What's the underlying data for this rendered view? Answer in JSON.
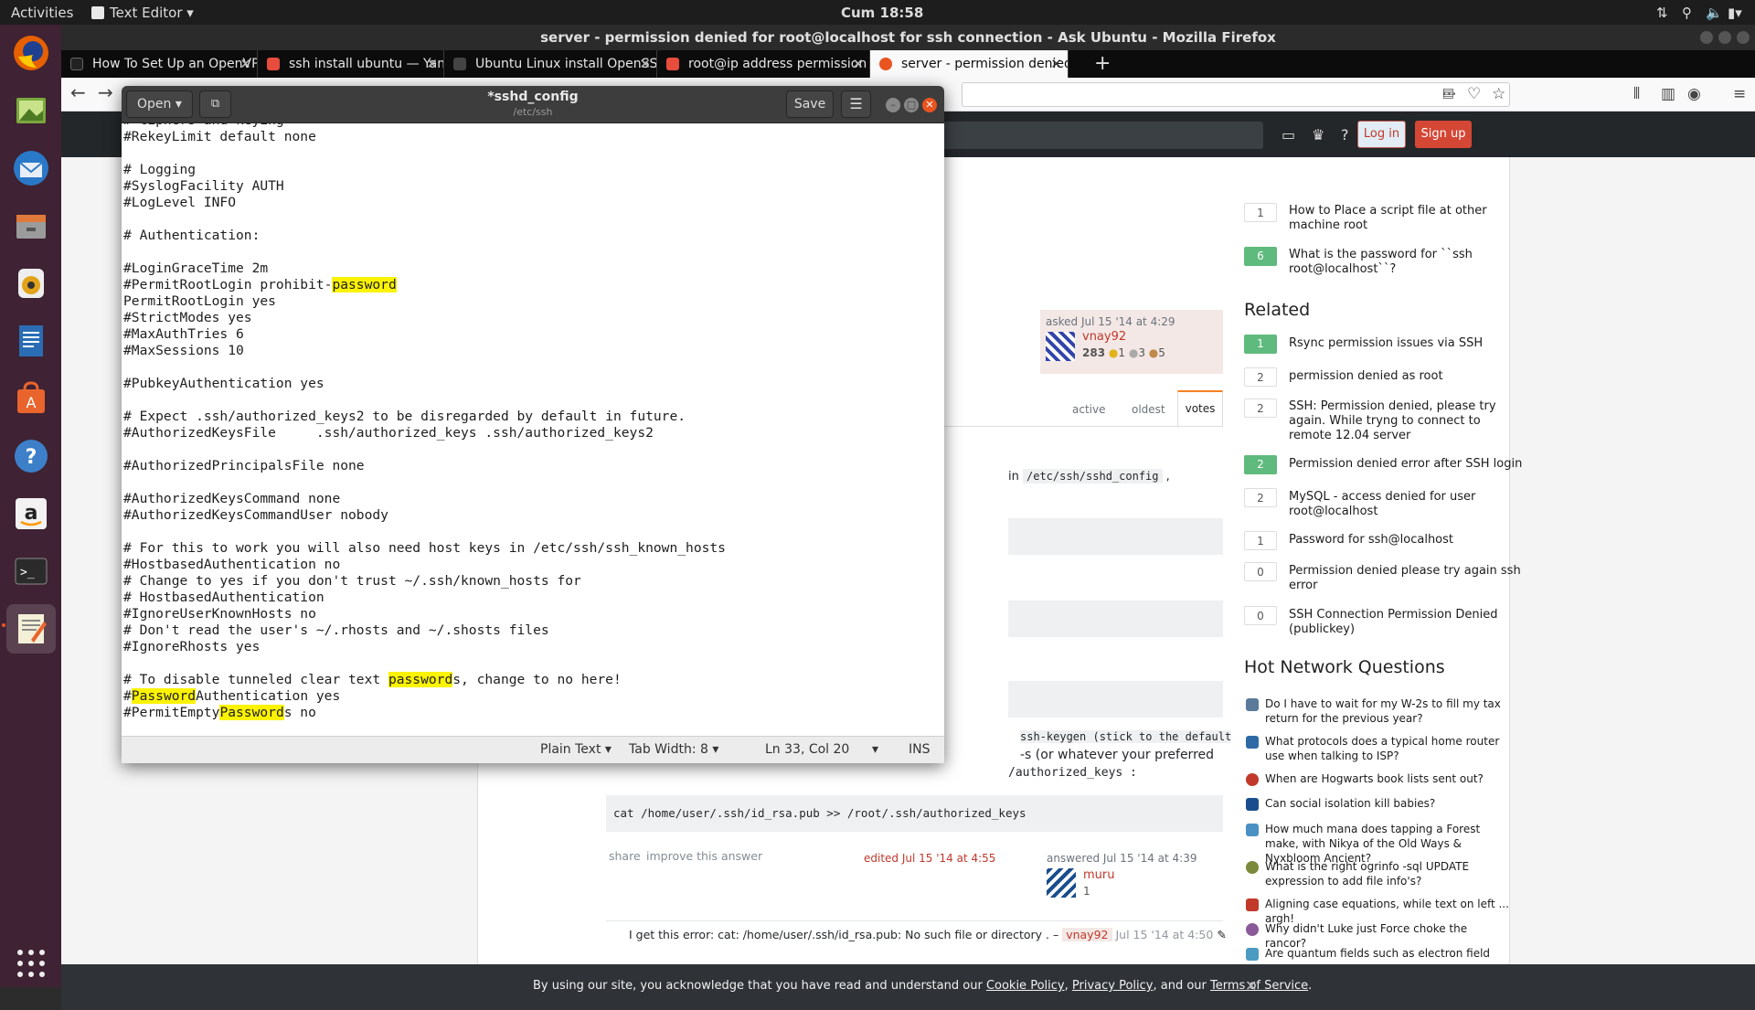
{
  "topbar": {
    "activities": "Activities",
    "app_menu": "Text Editor",
    "clock": "Cum 18:58"
  },
  "firefox": {
    "window_title": "server - permission denied for root@localhost for ssh connection - Ask Ubuntu - Mozilla Firefox",
    "tabs": [
      {
        "label": "How To Set Up an OpenVPN",
        "favicon_color": "#222222"
      },
      {
        "label": "ssh install ubuntu — Yandex",
        "favicon_color": "#e74c3c"
      },
      {
        "label": "Ubuntu Linux install OpenSSH",
        "favicon_color": "#444444"
      },
      {
        "label": "root@ip address permission",
        "favicon_color": "#e74c3c"
      },
      {
        "label": "server - permission denied",
        "favicon_color": "#e95420"
      }
    ]
  },
  "site": {
    "login_label": "Log in",
    "signup_label": "Sign up",
    "asked": "asked Jul 15 '14 at 4:29",
    "asker_name": "vnay92",
    "asker_rep": "283",
    "asker_badges": [
      "1",
      "3",
      "5"
    ],
    "sort_tabs": [
      "active",
      "oldest",
      "votes"
    ],
    "inline_code_path": "/etc/ssh/sshd_config",
    "inline_text_in": "in",
    "answer_text_1": "ssh-keygen (stick to the default",
    "answer_text_2": "-s (or whatever your preferred",
    "answer_text_3": "/authorized_keys :",
    "code_block": "cat /home/user/.ssh/id_rsa.pub >> /root/.ssh/authorized_keys",
    "share": "share",
    "improve": "improve this answer",
    "edited": "edited Jul 15 '14 at 4:55",
    "answered": "answered Jul 15 '14 at 4:39",
    "answerer_name": "muru",
    "answerer_rep": "1",
    "comment": "I get this error: cat: /home/user/.ssh/id_rsa.pub: No such file or directory . –",
    "comment_user": "vnay92",
    "comment_time": "Jul 15 '14 at 4:50",
    "linked": [
      {
        "votes": "1",
        "answered": false,
        "title": "How to Place a script file at other machine root"
      },
      {
        "votes": "6",
        "answered": true,
        "title": "What is the password for ``ssh root@localhost``?"
      }
    ],
    "related_heading": "Related",
    "related": [
      {
        "votes": "1",
        "answered": true,
        "title": "Rsync permission issues via SSH"
      },
      {
        "votes": "2",
        "answered": false,
        "title": "permission denied as root"
      },
      {
        "votes": "2",
        "answered": false,
        "title": "SSH: Permission denied, please try again. While tryng to connect to remote 12.04 server"
      },
      {
        "votes": "2",
        "answered": true,
        "title": "Permission denied error after SSH login"
      },
      {
        "votes": "2",
        "answered": false,
        "title": "MySQL - access denied for user root@localhost"
      },
      {
        "votes": "1",
        "answered": false,
        "title": "Password for ssh@localhost"
      },
      {
        "votes": "0",
        "answered": false,
        "title": "Permission denied please try again ssh error"
      },
      {
        "votes": "0",
        "answered": false,
        "title": "SSH Connection Permission Denied (publickey)"
      }
    ],
    "hnq_heading": "Hot Network Questions",
    "hnq": [
      {
        "title": "Do I have to wait for my W-2s to fill my tax return for the previous year?",
        "icon_color": "#5b7a9a"
      },
      {
        "title": "What protocols does a typical home router use when talking to ISP?",
        "icon_color": "#2d6aa3"
      },
      {
        "title": "When are Hogwarts book lists sent out?",
        "icon_color": "#c0392b"
      },
      {
        "title": "Can social isolation kill babies?",
        "icon_color": "#1a4d8c"
      },
      {
        "title": "How much mana does tapping a Forest make, with Nikya of the Old Ways & Nyxbloom Ancient?",
        "icon_color": "#4a90c2"
      },
      {
        "title": "What is the right ogrinfo -sql UPDATE expression to add file info's?",
        "icon_color": "#7a8a3a"
      },
      {
        "title": "Aligning case equations, while text on left ... argh!",
        "icon_color": "#c0392b"
      },
      {
        "title": "Why didn't Luke just Force choke the rancor?",
        "icon_color": "#8a5a9a"
      },
      {
        "title": "Are quantum fields such as electron field",
        "icon_color": "#4a9ac2"
      }
    ],
    "cookie_text": "By using our site, you acknowledge that you have read and understand our",
    "cookie_link1": "Cookie Policy",
    "cookie_sep1": ",",
    "cookie_link2": "Privacy Policy",
    "cookie_sep2": ", and our",
    "cookie_link3": "Terms of Service",
    "cookie_end": "."
  },
  "gedit": {
    "open_label": "Open",
    "title": "*sshd_config",
    "subtitle": "/etc/ssh",
    "save_label": "Save",
    "lines": [
      {
        "text": "# Ciphers and keying"
      },
      {
        "text": "#RekeyLimit default none"
      },
      {
        "text": ""
      },
      {
        "text": "# Logging"
      },
      {
        "text": "#SyslogFacility AUTH"
      },
      {
        "text": "#LogLevel INFO"
      },
      {
        "text": ""
      },
      {
        "text": "# Authentication:"
      },
      {
        "text": ""
      },
      {
        "text": "#LoginGraceTime 2m"
      },
      {
        "text": "#PermitRootLogin prohibit-",
        "hl": "password",
        "after": ""
      },
      {
        "text": "PermitRootLogin yes"
      },
      {
        "text": "#StrictModes yes"
      },
      {
        "text": "#MaxAuthTries 6"
      },
      {
        "text": "#MaxSessions 10"
      },
      {
        "text": ""
      },
      {
        "text": "#PubkeyAuthentication yes"
      },
      {
        "text": ""
      },
      {
        "text": "# Expect .ssh/authorized_keys2 to be disregarded by default in future."
      },
      {
        "text": "#AuthorizedKeysFile     .ssh/authorized_keys .ssh/authorized_keys2"
      },
      {
        "text": ""
      },
      {
        "text": "#AuthorizedPrincipalsFile none"
      },
      {
        "text": ""
      },
      {
        "text": "#AuthorizedKeysCommand none"
      },
      {
        "text": "#AuthorizedKeysCommandUser nobody"
      },
      {
        "text": ""
      },
      {
        "text": "# For this to work you will also need host keys in /etc/ssh/ssh_known_hosts"
      },
      {
        "text": "#HostbasedAuthentication no"
      },
      {
        "text": "# Change to yes if you don't trust ~/.ssh/known_hosts for"
      },
      {
        "text": "# HostbasedAuthentication"
      },
      {
        "text": "#IgnoreUserKnownHosts no"
      },
      {
        "text": "# Don't read the user's ~/.rhosts and ~/.shosts files"
      },
      {
        "text": "#IgnoreRhosts yes"
      },
      {
        "text": ""
      },
      {
        "text": "# To disable tunneled clear text ",
        "hl": "password",
        "after": "s, change to no here!"
      },
      {
        "text": "#",
        "hl": "Password",
        "after": "Authentication yes"
      },
      {
        "text": "#PermitEmpty",
        "hl": "Password",
        "after": "s no"
      }
    ],
    "status": {
      "language": "Plain Text",
      "tab_width": "Tab Width: 8",
      "position": "Ln 33, Col 20",
      "mode": "INS"
    }
  }
}
